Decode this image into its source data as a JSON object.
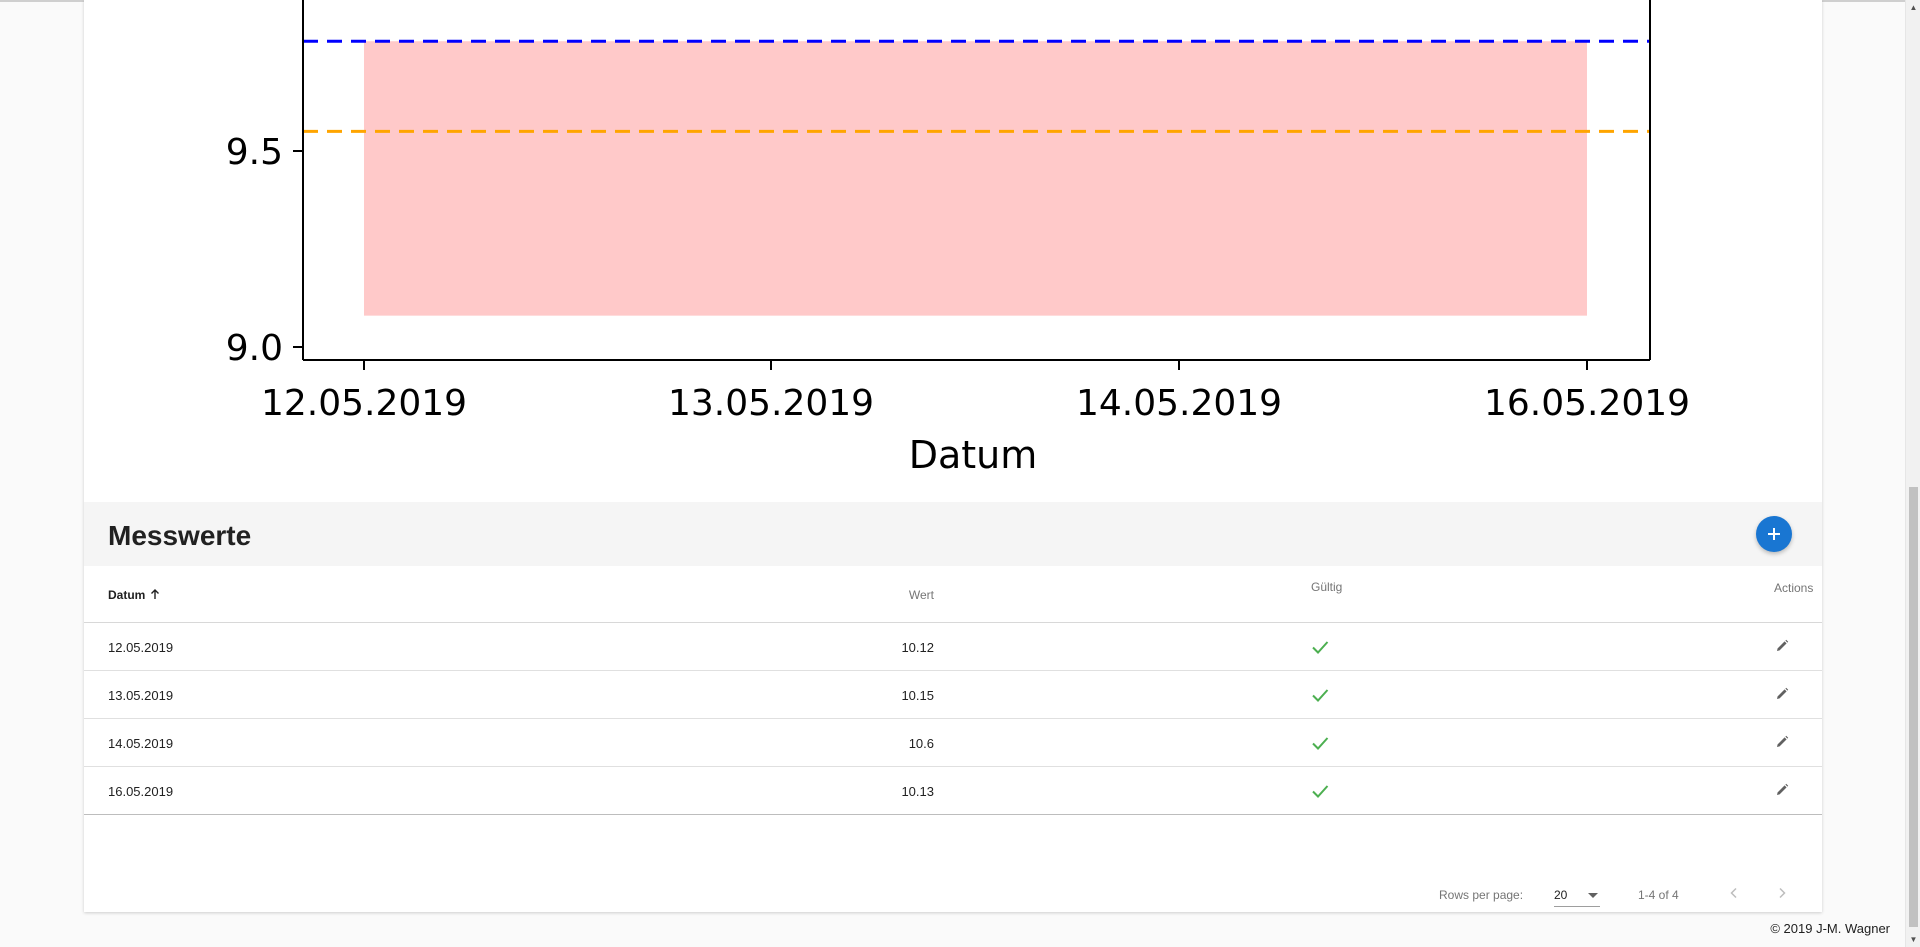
{
  "chart_data": {
    "type": "line",
    "xlabel": "Datum",
    "x_ticks": [
      "12.05.2019",
      "13.05.2019",
      "14.05.2019",
      "16.05.2019"
    ],
    "y_ticks": [
      9.0,
      9.5
    ],
    "ylim_visible": [
      8.97,
      9.86
    ],
    "reference_lines": [
      {
        "value": 9.78,
        "color": "#0000ff",
        "style": "dashed"
      },
      {
        "value": 9.55,
        "color": "#ffa500",
        "style": "dashed"
      }
    ],
    "band": {
      "x_from": "12.05.2019",
      "x_to": "16.05.2019",
      "y_from": 9.08,
      "y_to": 9.78,
      "color": "#ffc9c9"
    }
  },
  "section": {
    "title": "Messwerte",
    "add_icon": "plus-icon"
  },
  "table": {
    "headers": {
      "datum": "Datum",
      "datum_sort_icon": "arrow-up-icon",
      "wert": "Wert",
      "gueltig": "Gültig",
      "actions": "Actions"
    },
    "rows": [
      {
        "datum": "12.05.2019",
        "wert": "10.12",
        "gueltig": "check-icon",
        "action": "edit-icon"
      },
      {
        "datum": "13.05.2019",
        "wert": "10.15",
        "gueltig": "check-icon",
        "action": "edit-icon"
      },
      {
        "datum": "14.05.2019",
        "wert": "10.6",
        "gueltig": "check-icon",
        "action": "edit-icon"
      },
      {
        "datum": "16.05.2019",
        "wert": "10.13",
        "gueltig": "check-icon",
        "action": "edit-icon"
      }
    ]
  },
  "pagination": {
    "rows_per_page_label": "Rows per page:",
    "rows_per_page_value": "20",
    "page_info": "1-4 of 4"
  },
  "footer": {
    "copyright": "© 2019 J-M. Wagner"
  },
  "colors": {
    "accent": "#1976d2",
    "check": "#4caf50",
    "band": "#ffc9c9",
    "line_blue": "#0000ff",
    "line_orange": "#ffa500"
  }
}
